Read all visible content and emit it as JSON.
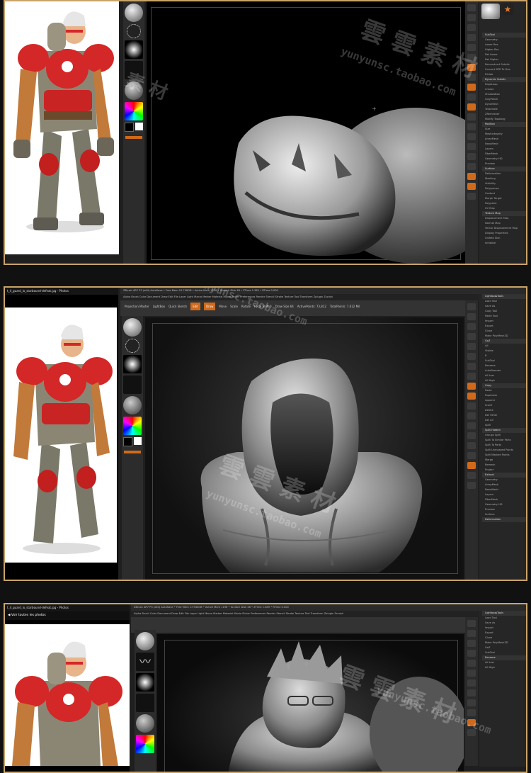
{
  "frames": [
    {
      "name": "screenshot-1",
      "panel_items": [
        "SubTool",
        "Geometry",
        "Lower Res",
        "Higher Res",
        "Del Lower",
        "Del Higher",
        "Reconstruct Subdiv",
        "Convert BPR To Geo",
        "Divide",
        "Dynamic Subdiv",
        "EdgeLoop",
        "Crease",
        "ShadowBox",
        "ClayPolish",
        "DynaMesh",
        "Tessimate",
        "ZRemesher",
        "Modify Topology",
        "Position",
        "Size",
        "MeshIntegrity",
        "ArrayMesh",
        "NanoMesh",
        "Layers",
        "FiberMesh",
        "Geometry HD",
        "Preview",
        "Surface",
        "Deformation",
        "Masking",
        "Visibility",
        "Polygroups",
        "Contact",
        "Morph Target",
        "Polypaint",
        "UV Map",
        "Texture Map",
        "Displacement Map",
        "Normal Map",
        "Vector Displacement Map",
        "Display Properties",
        "Unified Skin",
        "Initialize"
      ]
    },
    {
      "name": "screenshot-2",
      "title_bar": "t_4_guard_lo_starbound-defeat.jpg - Photos",
      "zbrush_title": "ZBrush 4R7 P3 (x64)   AutoSave   • Free Mem 15.738GB • Active Mem 1128 • Scratch Disk 48 • ZTime 1.362 • RTime 0.000",
      "menu": "Alpha  Brush  Color  Document  Draw  Edit  File  Layer  Light  Macro  Marker  Material  Movie  Picker  Preferences  Render  Stencil  Stroke  Texture  Tool  Transform  Zplugin  Zscript",
      "toolbar": [
        "Projection Master",
        "LightBox",
        "Quick Sketch",
        "Edit",
        "Draw",
        "Move",
        "Scale",
        "Rotate"
      ],
      "stats": [
        "Focal Shift 0",
        "Draw Size 64",
        "ActivePoints: 73,812",
        "TotalPoints: 7.612 Mil"
      ],
      "panel_items": [
        "Lightbox▸Tools",
        "Load Tool",
        "Save As",
        "Copy Tool",
        "Paste Tool",
        "Import",
        "Export",
        "Clone",
        "Make PolyMesh3D",
        "GoZ",
        "All",
        "Visible",
        "R",
        "SubTool",
        "Rename",
        "AutoReorder",
        "All Low",
        "All High",
        "Copy",
        "Paste",
        "Duplicate",
        "Append",
        "Insert",
        "Delete",
        "Del Other",
        "Del All",
        "Split",
        "Split Hidden",
        "Groups Split",
        "Split To Similar Parts",
        "Split To Parts",
        "Split Unmasked Points",
        "Split Masked Points",
        "Merge",
        "Remesh",
        "Project",
        "Extract",
        "Geometry",
        "ArrayMesh",
        "NanoMesh",
        "Layers",
        "FiberMesh",
        "Geometry HD",
        "Preview",
        "Surface",
        "Deformation"
      ]
    },
    {
      "name": "screenshot-3",
      "photos_title": "t_4_guard_lo_starbound-defeat.jpg - Photos",
      "photos_back": "Voir toutes les photos",
      "zbrush_title": "ZBrush 4R7 P3 (x64)   AutoSave   • Free Mem 17.940GB • Active Mem 1196 • Scratch Disk 48 • ZTime 1.389 • RTime 0.000",
      "menu": "Alpha  Brush  Color  Document  Draw  Edit  File  Layer  Light  Macro  Marker  Material  Movie  Picker  Preferences  Render  Stencil  Stroke  Texture  Tool  Transform  Zplugin  Zscript",
      "panel_items": [
        "Lightbox▸Tools",
        "Load Tool",
        "Save As",
        "Import",
        "Export",
        "Clone",
        "Make PolyMesh3D",
        "GoZ",
        "SubTool",
        "Rename",
        "All Low",
        "All High"
      ]
    }
  ],
  "watermark": {
    "chars": "雲 雲 素 材",
    "url": "yunyunsc.taobao.com"
  },
  "colors": {
    "frame_border": "#c9a46a",
    "accent": "#d06a1a",
    "ui_bg": "#2a2a2a"
  }
}
